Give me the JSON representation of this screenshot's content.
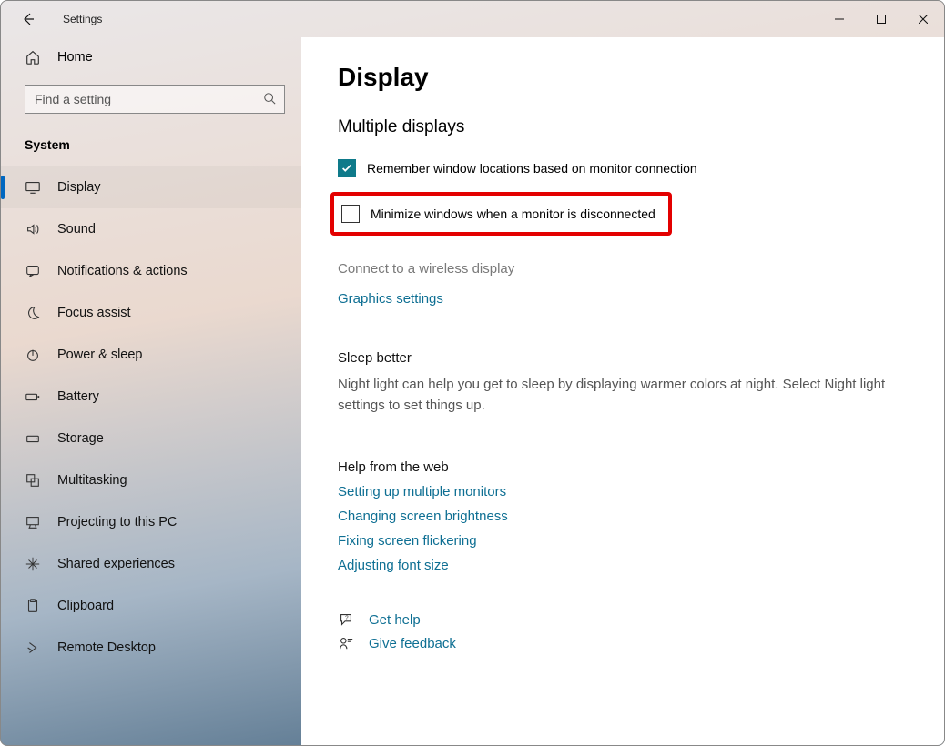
{
  "title": "Settings",
  "home_label": "Home",
  "search_placeholder": "Find a setting",
  "section_header": "System",
  "nav": [
    {
      "key": "display",
      "label": "Display",
      "active": true
    },
    {
      "key": "sound",
      "label": "Sound"
    },
    {
      "key": "notifications",
      "label": "Notifications & actions"
    },
    {
      "key": "focus",
      "label": "Focus assist"
    },
    {
      "key": "power",
      "label": "Power & sleep"
    },
    {
      "key": "battery",
      "label": "Battery"
    },
    {
      "key": "storage",
      "label": "Storage"
    },
    {
      "key": "multitask",
      "label": "Multitasking"
    },
    {
      "key": "projecting",
      "label": "Projecting to this PC"
    },
    {
      "key": "shared",
      "label": "Shared experiences"
    },
    {
      "key": "clipboard",
      "label": "Clipboard"
    },
    {
      "key": "remote",
      "label": "Remote Desktop"
    }
  ],
  "page": {
    "title": "Display",
    "section": "Multiple displays",
    "checkbox1": "Remember window locations based on monitor connection",
    "checkbox2": "Minimize windows when a monitor is disconnected",
    "wireless": "Connect to a wireless display",
    "graphics_link": "Graphics settings",
    "sleep_header": "Sleep better",
    "sleep_desc": "Night light can help you get to sleep by displaying warmer colors at night. Select Night light settings to set things up.",
    "help_header": "Help from the web",
    "help_links": [
      "Setting up multiple monitors",
      "Changing screen brightness",
      "Fixing screen flickering",
      "Adjusting font size"
    ],
    "get_help": "Get help",
    "feedback": "Give feedback"
  }
}
